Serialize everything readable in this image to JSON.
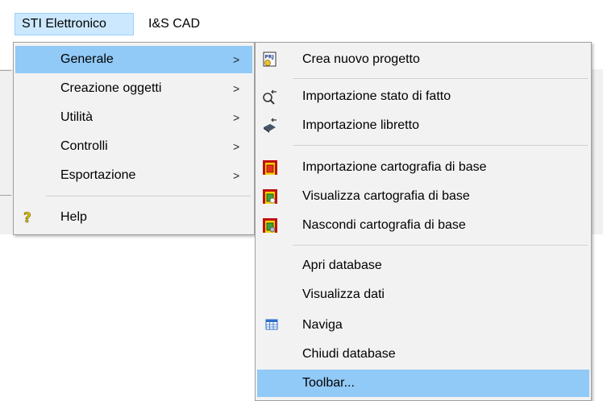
{
  "menubar": {
    "items": [
      {
        "label": "STI Elettronico",
        "active": true
      },
      {
        "label": "I&S CAD",
        "active": false
      }
    ]
  },
  "main_menu": {
    "items": [
      {
        "label": "Generale",
        "submenu": true,
        "highlighted": true
      },
      {
        "label": "Creazione oggetti",
        "submenu": true
      },
      {
        "label": "Utilità",
        "submenu": true
      },
      {
        "label": "Controlli",
        "submenu": true
      },
      {
        "label": "Esportazione",
        "submenu": true
      },
      {
        "label": "Help",
        "icon": "question-icon"
      }
    ],
    "arrow": ">"
  },
  "sub_menu": {
    "items": [
      {
        "label": "Crea nuovo progetto",
        "icon": "new-project-icon"
      },
      {
        "label": "Importazione stato di fatto",
        "icon": "import-state-icon"
      },
      {
        "label": "Importazione libretto",
        "icon": "import-booklet-icon"
      },
      {
        "label": "Importazione cartografia di base",
        "icon": "import-map-icon"
      },
      {
        "label": "Visualizza cartografia di base",
        "icon": "show-map-icon"
      },
      {
        "label": "Nascondi cartografia di base",
        "icon": "hide-map-icon"
      },
      {
        "label": "Apri database"
      },
      {
        "label": "Visualizza dati"
      },
      {
        "label": "Naviga",
        "icon": "grid-icon"
      },
      {
        "label": "Chiudi database"
      },
      {
        "label": "Toolbar...",
        "highlighted": true
      }
    ]
  },
  "colors": {
    "highlight": "#91c9f7",
    "menubar_active": "#cce8ff",
    "menu_bg": "#f2f2f2"
  }
}
